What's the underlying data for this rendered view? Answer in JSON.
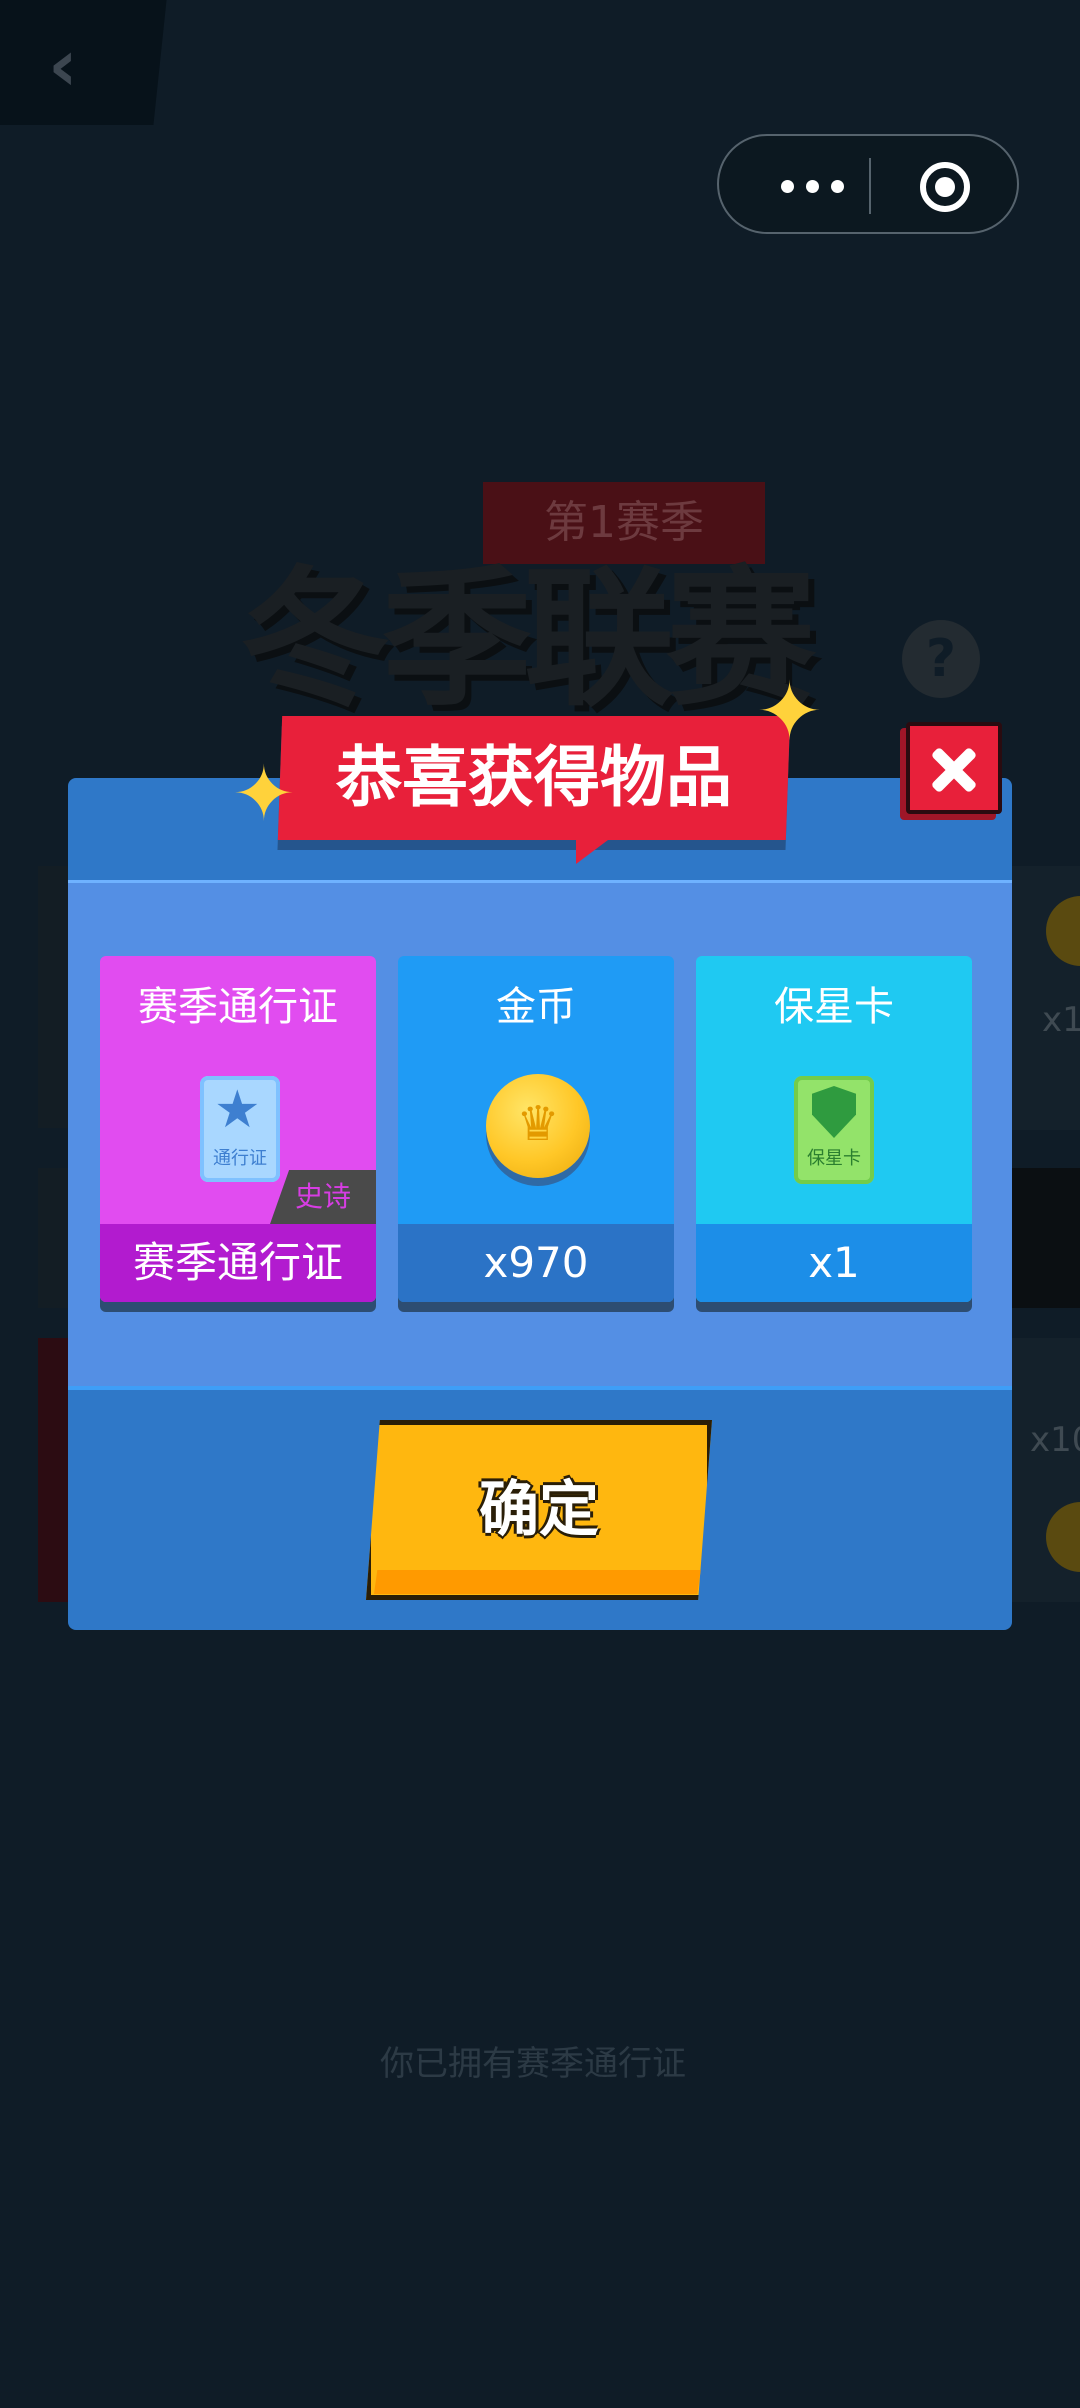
{
  "background": {
    "season_label": "第1赛季",
    "league_title": "冬季联赛",
    "help_symbol": "?",
    "owned_text": "你已拥有赛季通行证",
    "side_amounts": [
      "x1",
      "x10"
    ]
  },
  "dialog": {
    "title": "恭喜获得物品",
    "items": [
      {
        "name": "赛季通行证",
        "badge": "史诗",
        "footer": "赛季通行证",
        "icon": "pass-card-icon",
        "icon_text": "通行证",
        "bg": "#e14cf0",
        "foot_bg": "#b21bcf"
      },
      {
        "name": "金币",
        "footer": "x970",
        "icon": "coin-icon",
        "bg": "#1f9bf5",
        "foot_bg": "#2b73c6"
      },
      {
        "name": "保星卡",
        "footer": "x1",
        "icon": "shield-card-icon",
        "icon_text": "保星卡",
        "bg": "#1fc9f2",
        "foot_bg": "#1c8ee8"
      }
    ],
    "confirm_label": "确定"
  },
  "colors": {
    "dialog_bg": "#2f78c8",
    "ribbon_red": "#e8203a",
    "confirm_yellow": "#ffb70f"
  }
}
